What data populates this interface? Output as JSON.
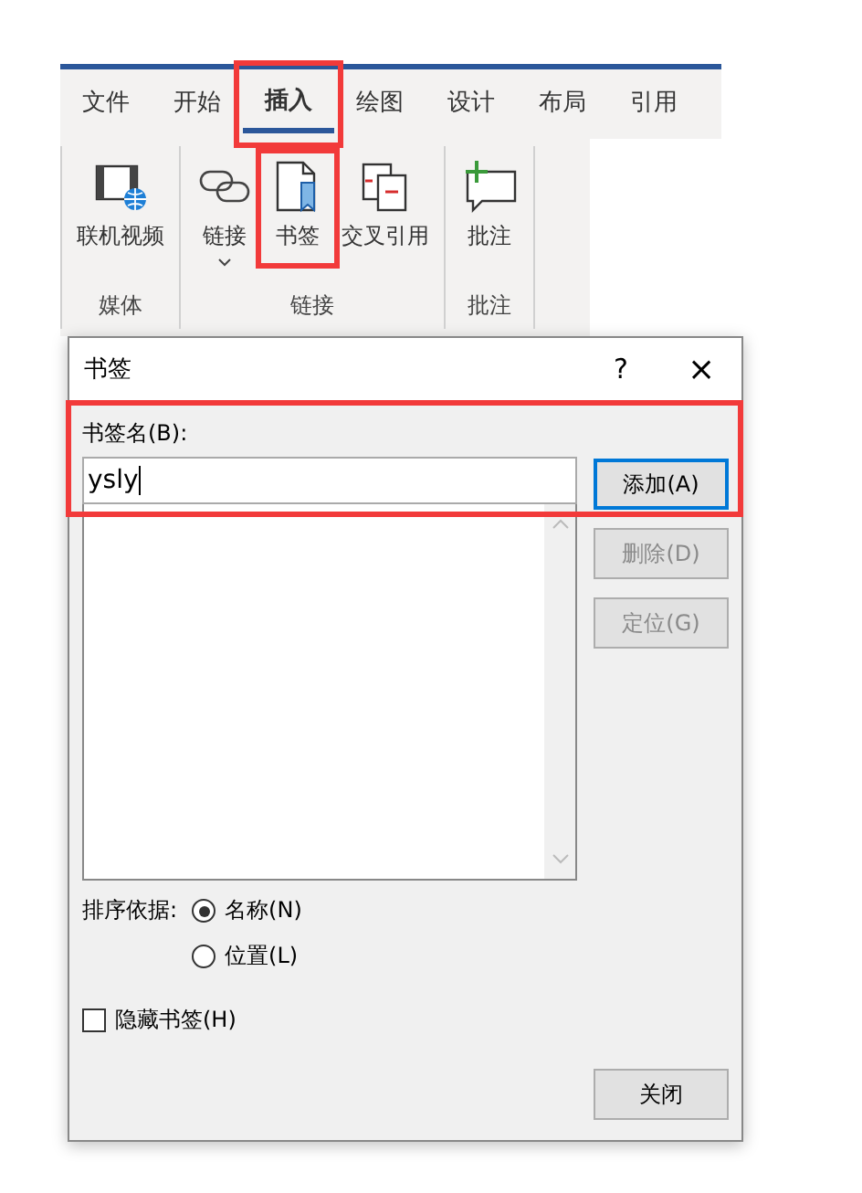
{
  "ribbon": {
    "tabs": [
      {
        "label": "文件",
        "selected": false,
        "highlighted": false
      },
      {
        "label": "开始",
        "selected": false,
        "highlighted": false
      },
      {
        "label": "插入",
        "selected": true,
        "highlighted": true
      },
      {
        "label": "绘图",
        "selected": false,
        "highlighted": false
      },
      {
        "label": "设计",
        "selected": false,
        "highlighted": false
      },
      {
        "label": "布局",
        "selected": false,
        "highlighted": false
      },
      {
        "label": "引用",
        "selected": false,
        "highlighted": false
      }
    ],
    "groups": [
      {
        "label": "媒体",
        "commands": [
          {
            "kind": "video",
            "label": "联机视频",
            "dropdown": false,
            "highlighted": false
          }
        ]
      },
      {
        "label": "链接",
        "commands": [
          {
            "kind": "link",
            "label": "链接",
            "dropdown": true,
            "highlighted": false
          },
          {
            "kind": "bookmark",
            "label": "书签",
            "dropdown": false,
            "highlighted": true
          },
          {
            "kind": "crossref",
            "label": "交叉引用",
            "dropdown": false,
            "highlighted": false
          }
        ]
      },
      {
        "label": "批注",
        "commands": [
          {
            "kind": "comment",
            "label": "批注",
            "dropdown": false,
            "highlighted": false
          }
        ]
      }
    ]
  },
  "dialog": {
    "title": "书签",
    "help": "?",
    "close": "×",
    "name_label": "书签名(B):",
    "name_value": "ysly",
    "name_highlighted": true,
    "buttons": [
      {
        "label": "添加(A)",
        "disabled": false,
        "default": true
      },
      {
        "label": "删除(D)",
        "disabled": true,
        "default": false
      },
      {
        "label": "定位(G)",
        "disabled": true,
        "default": false
      }
    ],
    "sort_label": "排序依据:",
    "sort_options": [
      {
        "label": "名称(N)",
        "selected": true
      },
      {
        "label": "位置(L)",
        "selected": false
      }
    ],
    "hidden_checkbox": {
      "label": "隐藏书签(H)",
      "checked": false
    },
    "close_button": "关闭"
  }
}
